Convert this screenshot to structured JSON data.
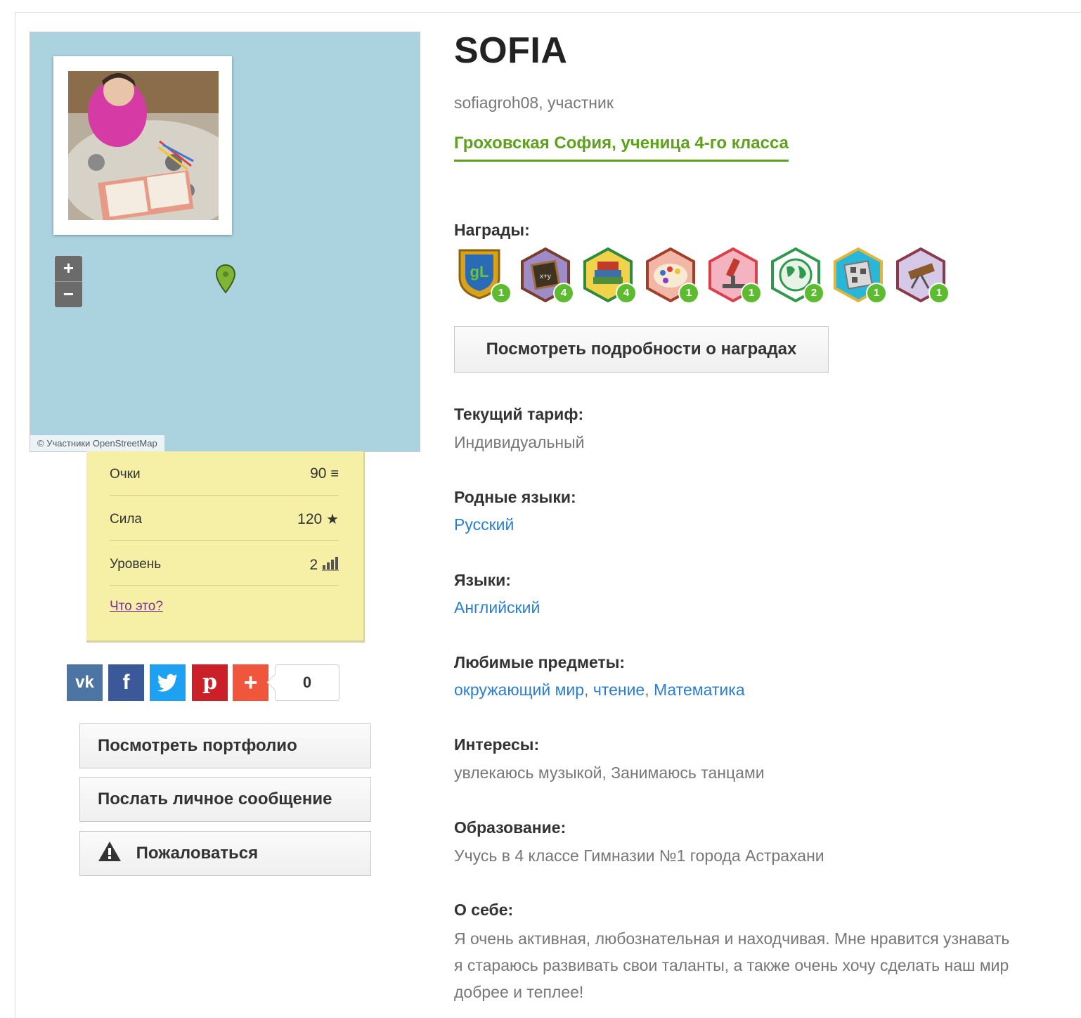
{
  "map": {
    "zoom_in": "+",
    "zoom_out": "−",
    "attribution": "© Участники OpenStreetMap"
  },
  "stats": {
    "rows": [
      {
        "label": "Очки",
        "value": "90",
        "icon": "coins-icon"
      },
      {
        "label": "Сила",
        "value": "120",
        "icon": "star-icon"
      },
      {
        "label": "Уровень",
        "value": "2",
        "icon": "level-bars-icon"
      }
    ],
    "help_link": "Что это?"
  },
  "social": {
    "share_count": "0",
    "buttons": [
      {
        "name": "vk",
        "color": "#4c75a3"
      },
      {
        "name": "facebook",
        "color": "#3b5998"
      },
      {
        "name": "twitter",
        "color": "#1da1f2"
      },
      {
        "name": "pinterest",
        "color": "#cb2027"
      },
      {
        "name": "more",
        "color": "#f0563b"
      }
    ]
  },
  "actions": {
    "portfolio": "Посмотреть портфолио",
    "message": "Послать личное сообщение",
    "report": "Пожаловаться"
  },
  "profile": {
    "name": "SOFIA",
    "user_line": "sofiagroh08, участник",
    "full_name": "Гроховская София, ученица 4-го класса"
  },
  "awards": {
    "label": "Награды:",
    "items": [
      {
        "icon": "globallab-shield-icon",
        "count": "1"
      },
      {
        "icon": "chalkboard-icon",
        "count": "4"
      },
      {
        "icon": "books-icon",
        "count": "4"
      },
      {
        "icon": "palette-icon",
        "count": "1"
      },
      {
        "icon": "microscope-icon",
        "count": "1"
      },
      {
        "icon": "globe-icon",
        "count": "2"
      },
      {
        "icon": "qr-code-icon",
        "count": "1"
      },
      {
        "icon": "telescope-icon",
        "count": "1"
      }
    ],
    "details_button": "Посмотреть подробности о наградах"
  },
  "sections": {
    "tariff_label": "Текущий тариф:",
    "tariff_value": "Индивидуальный",
    "native_label": "Родные языки:",
    "native_value": "Русский",
    "languages_label": "Языки:",
    "languages_value": "Английский",
    "subjects_label": "Любимые предметы:",
    "subjects": [
      "окружающий мир",
      "чтение",
      "Математика"
    ],
    "interests_label": "Интересы:",
    "interests_value": "увлекаюсь музыкой, Занимаюсь танцами",
    "education_label": "Образование:",
    "education_value": "Учусь в 4 классе Гимназии №1 города Астрахани",
    "about_label": "О себе:",
    "about_lines": [
      "Я очень активная, любознательная и находчивая. Мне нравится узнавать",
      "я стараюсь развивать свои таланты, а также очень хочу сделать наш мир",
      "добрее и теплее!"
    ]
  }
}
